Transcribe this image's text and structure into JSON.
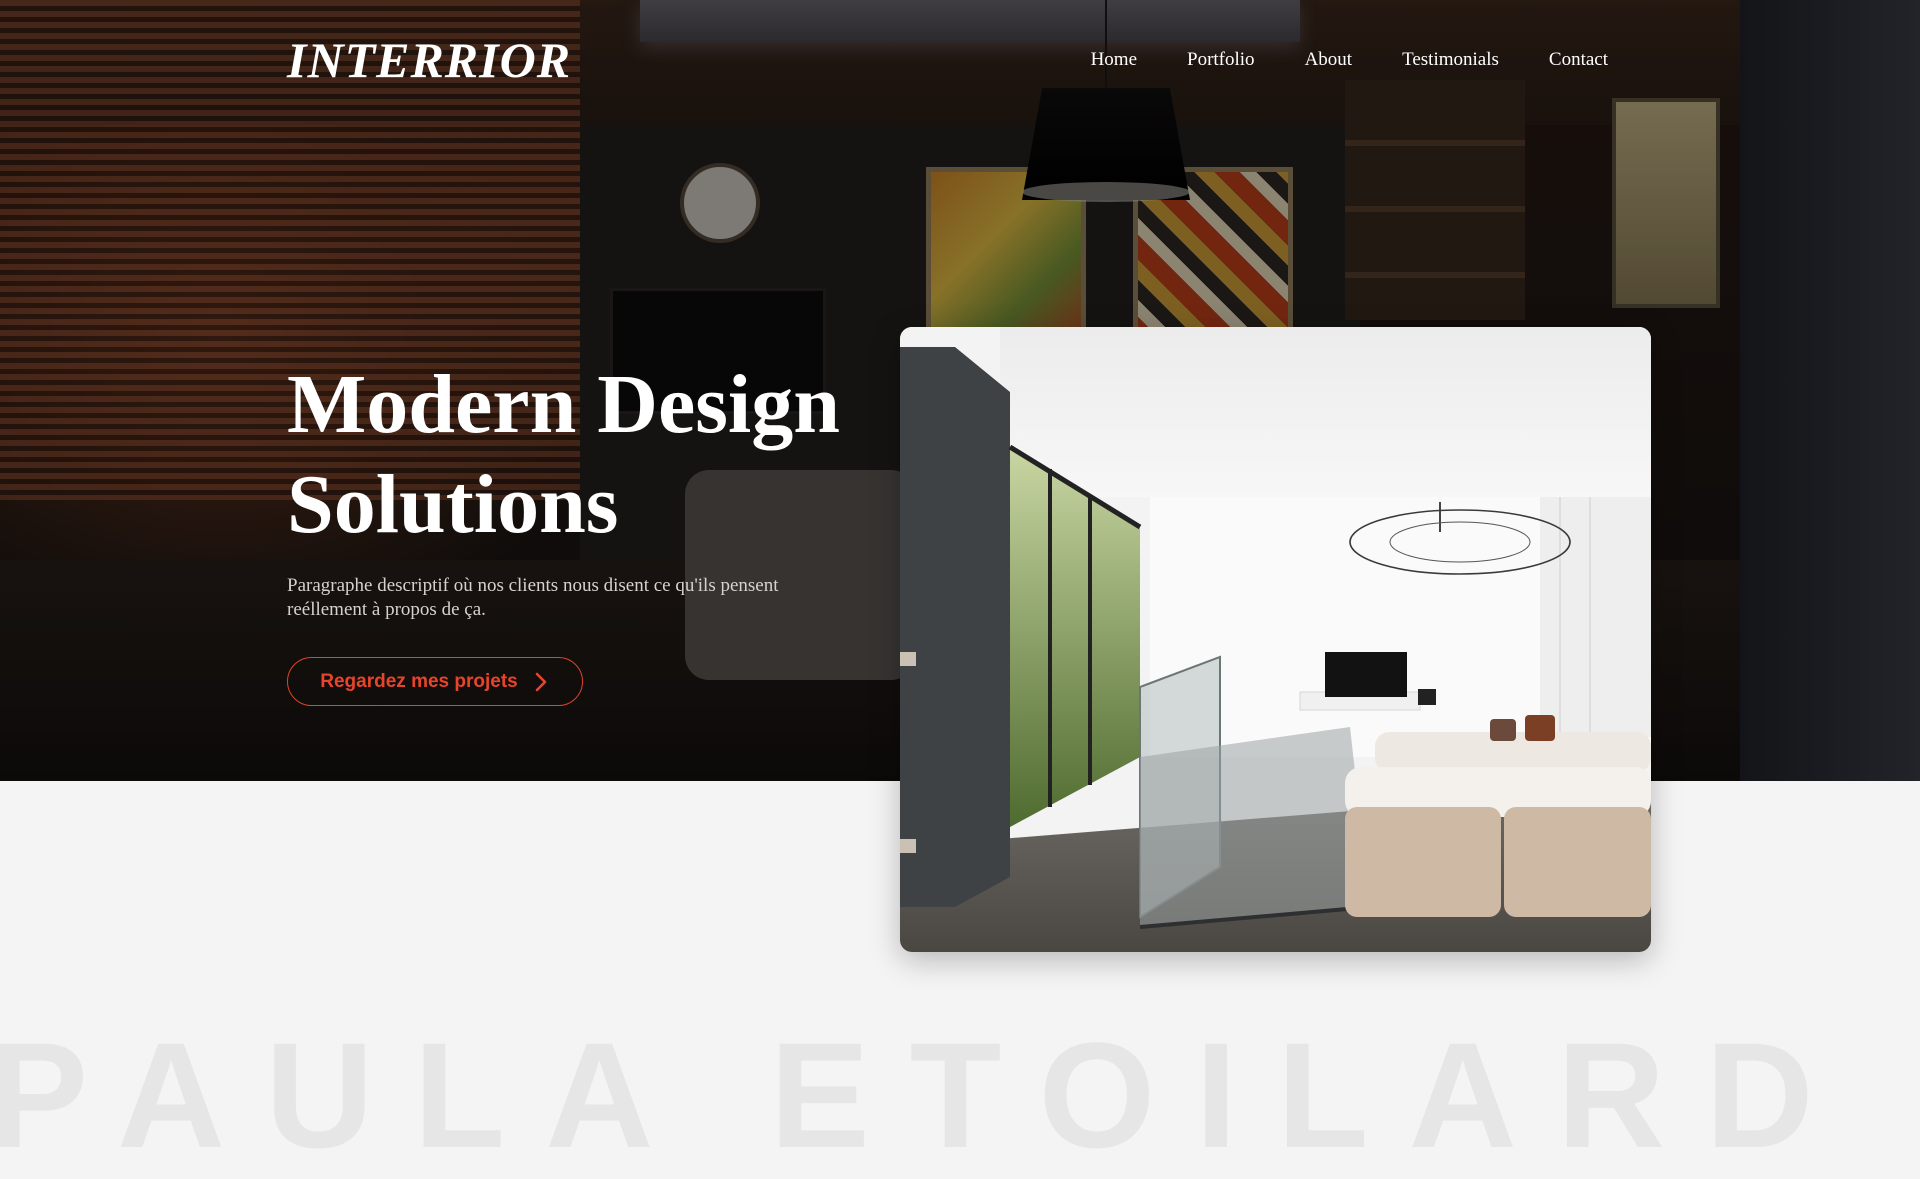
{
  "brand": {
    "logo": "INTERRIOR"
  },
  "nav": {
    "items": [
      {
        "label": "Home"
      },
      {
        "label": "Portfolio"
      },
      {
        "label": "About"
      },
      {
        "label": "Testimonials"
      },
      {
        "label": "Contact"
      }
    ]
  },
  "hero": {
    "title_line1": "Modern Design",
    "title_line2": "Solutions",
    "description": "Paragraphe descriptif où nos clients nous disent ce qu'ils pensent reéllement à propos de ça.",
    "cta_label": "Regardez mes projets",
    "cta_icon": "chevron-right-icon"
  },
  "colors": {
    "accent": "#e8442b",
    "page_background": "#f4f4f4",
    "hero_text": "#ffffff"
  },
  "watermark": {
    "text": "PAULA ETOILARD"
  }
}
